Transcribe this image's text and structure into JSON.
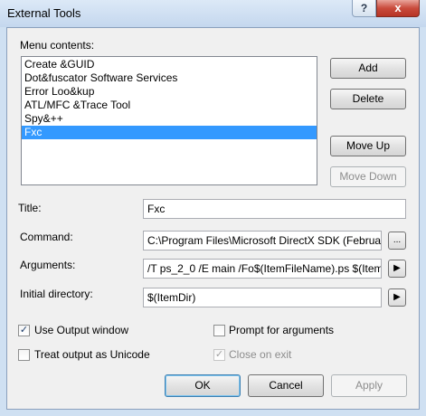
{
  "window": {
    "title": "External Tools",
    "help_label": "?",
    "close_label": "x"
  },
  "menu_contents_label": "Menu contents:",
  "menu_items": [
    {
      "label": "Create &GUID"
    },
    {
      "label": "Dot&fuscator Software Services"
    },
    {
      "label": "Error Loo&kup"
    },
    {
      "label": "ATL/MFC &Trace Tool"
    },
    {
      "label": "Spy&++"
    },
    {
      "label": "Fxc"
    }
  ],
  "buttons": {
    "add": "Add",
    "delete": "Delete",
    "move_up": "Move Up",
    "move_down": "Move Down"
  },
  "title_field": {
    "label": "Title:",
    "value": "Fxc"
  },
  "command_field": {
    "label": "Command:",
    "value": "C:\\Program Files\\Microsoft DirectX SDK (Februar",
    "browse_label": "..."
  },
  "arguments_field": {
    "label": "Arguments:",
    "value": "/T ps_2_0  /E main /Fo$(ItemFileName).ps $(Item",
    "menu_arrow": "▶"
  },
  "initial_directory_field": {
    "label": "Initial directory:",
    "value": "$(ItemDir)",
    "menu_arrow": "▶"
  },
  "options": {
    "use_output_window": {
      "label": "Use Output window",
      "checked": "✓"
    },
    "treat_output_unicode": {
      "label": "Treat output as Unicode"
    },
    "prompt_for_arguments": {
      "label": "Prompt for arguments"
    },
    "close_on_exit": {
      "label": "Close on exit",
      "checked": "✓"
    }
  },
  "footer": {
    "ok": "OK",
    "cancel": "Cancel",
    "apply": "Apply"
  }
}
